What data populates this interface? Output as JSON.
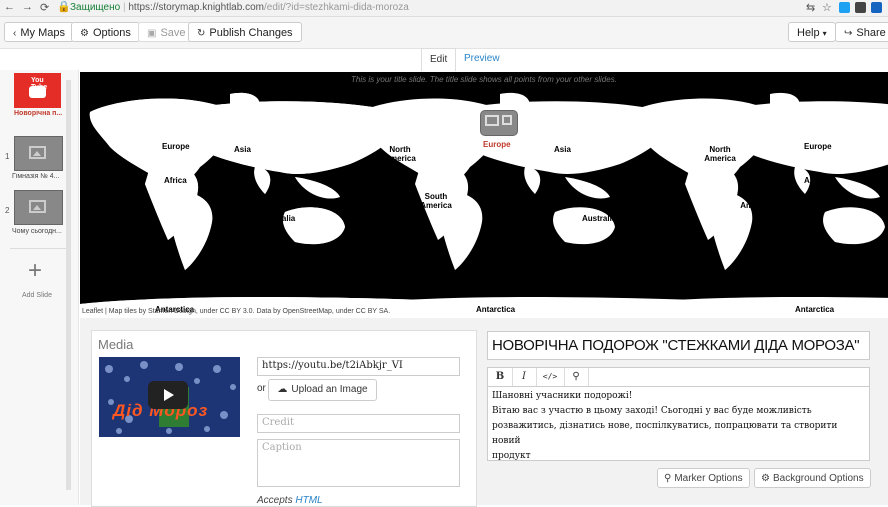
{
  "browser": {
    "secure_label": "Защищено",
    "url_host": "https://storymap.knightlab.com",
    "url_path": "/edit/?id=stezhkami-dida-moroza"
  },
  "toolbar": {
    "my_maps": "My Maps",
    "options": "Options",
    "save": "Save",
    "publish": "Publish Changes",
    "help": "Help",
    "share": "Share"
  },
  "tabs": {
    "edit": "Edit",
    "preview": "Preview"
  },
  "sidebar": {
    "title_slide_caption": "Новорічна п...",
    "title_slide_logo": "You Tube",
    "slides": [
      {
        "num": "1",
        "caption": "Гімназія № 4..."
      },
      {
        "num": "2",
        "caption": "Чому сьогодн..."
      }
    ],
    "add_slide": "Add Slide"
  },
  "map": {
    "hint": "This is your title slide. The title slide shows all points from your other slides.",
    "attribution": "Leaflet | Map tiles by Stamen Design, under CC BY 3.0. Data by OpenStreetMap, under CC BY SA.",
    "continent_labels": [
      "Europe",
      "Asia",
      "North America",
      "Africa",
      "South America",
      "Australia",
      "Antarctica"
    ],
    "marker_label": "Europe"
  },
  "media": {
    "heading": "Media",
    "url_value": "https://youtu.be/t2iAbkjr_VI",
    "or_label": "or",
    "upload_label": "Upload an Image",
    "credit_placeholder": "Credit",
    "caption_placeholder": "Caption",
    "accepts_label": "Accepts",
    "accepts_link": "HTML",
    "thumb_text": "Дід Мороз"
  },
  "text": {
    "headline": "НОВОРІЧНА ПОДОРОЖ \"СТЕЖКАМИ ДІДА МОРОЗА\"",
    "editor_buttons": [
      "B",
      "I",
      "</>",
      "🔗"
    ],
    "body_lines": [
      "Шановні учасники подорожі!",
      "Вітаю вас з участю в цьому заході! Сьогодні у вас буде можливість",
      "розважитись, дізнатись нове, поспілкуватись, попрацювати та створити новий",
      "продукт"
    ]
  },
  "options_buttons": {
    "marker": "Marker Options",
    "background": "Background Options"
  },
  "colors": {
    "accent": "#2a84c9",
    "youtube_red": "#e52d27",
    "map_water": "#000000",
    "map_land": "#ffffff"
  }
}
